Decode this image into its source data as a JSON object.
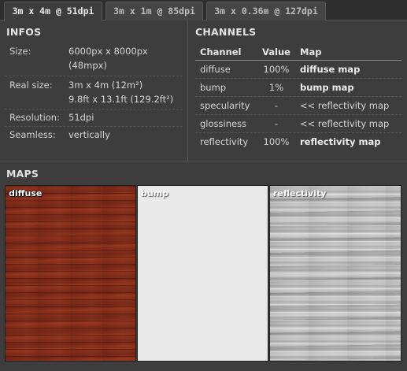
{
  "tabs": [
    {
      "label": "3m x 4m @ 51dpi",
      "active": true
    },
    {
      "label": "3m x 1m @ 85dpi",
      "active": false
    },
    {
      "label": "3m x 0.36m @ 127dpi",
      "active": false
    }
  ],
  "infos": {
    "title": "INFOS",
    "rows": [
      {
        "key": "Size:",
        "value": [
          "6000px x 8000px",
          "(48mpx)"
        ]
      },
      {
        "key": "Real size:",
        "value": [
          "3m x 4m (12m²)",
          "9.8ft x 13.1ft (129.2ft²)"
        ]
      },
      {
        "key": "Resolution:",
        "value": [
          "51dpi"
        ]
      },
      {
        "key": "Seamless:",
        "value": [
          "vertically"
        ]
      }
    ]
  },
  "channels": {
    "title": "CHANNELS",
    "headers": {
      "channel": "Channel",
      "value": "Value",
      "map": "Map"
    },
    "rows": [
      {
        "channel": "diffuse",
        "value": "100%",
        "map": "diffuse map",
        "map_bold": true
      },
      {
        "channel": "bump",
        "value": "1%",
        "map": "bump map",
        "map_bold": true
      },
      {
        "channel": "specularity",
        "value": "-",
        "map": "<< reflectivity map",
        "map_bold": false
      },
      {
        "channel": "glossiness",
        "value": "-",
        "map": "<< reflectivity map",
        "map_bold": false
      },
      {
        "channel": "reflectivity",
        "value": "100%",
        "map": "reflectivity map",
        "map_bold": true
      }
    ]
  },
  "maps": {
    "title": "MAPS",
    "items": [
      {
        "label": "diffuse",
        "color": "#8a2f1c"
      },
      {
        "label": "bump",
        "color": "#e9e9e9"
      },
      {
        "label": "reflectivity",
        "color": "#b9b9b9"
      }
    ]
  }
}
